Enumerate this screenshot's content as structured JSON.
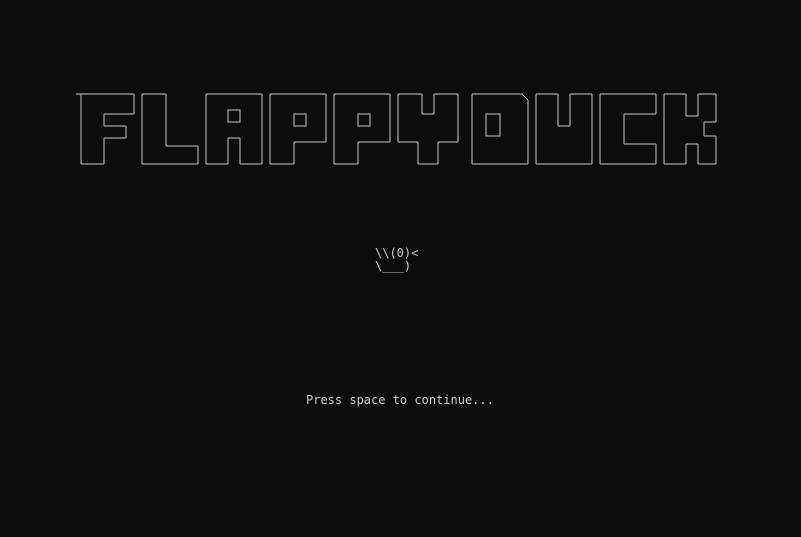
{
  "game": {
    "title_art_text": "FLAPPY DUCK",
    "duck_art": "\\\\(0)<\n\\___)",
    "prompt": "Press space to continue..."
  },
  "colors": {
    "background": "#0c0c0c",
    "foreground": "#cccccc"
  },
  "icons": {
    "title": "ascii-block-letters",
    "duck": "ascii-duck"
  }
}
